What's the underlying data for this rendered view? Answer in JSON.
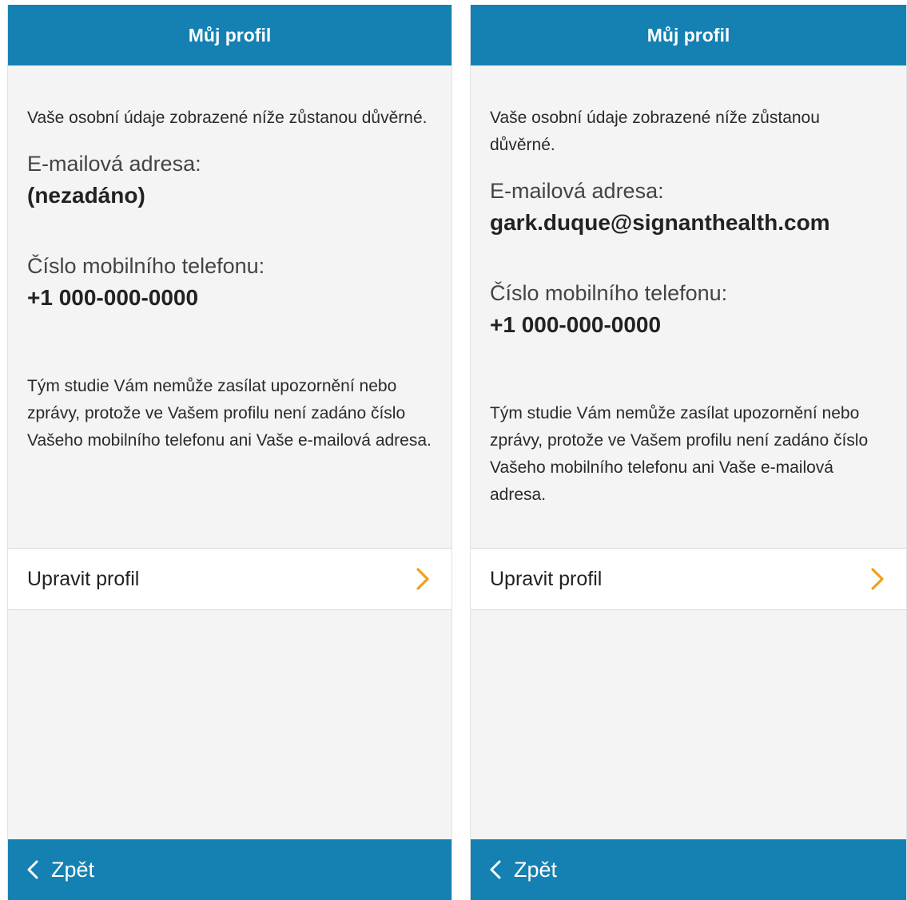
{
  "colors": {
    "header_bg": "#1580b2",
    "accent_chevron": "#f0a01a",
    "screen_bg": "#f4f4f4"
  },
  "screens": [
    {
      "header_title": "Můj profil",
      "intro": "Vaše osobní údaje zobrazené níže zůstanou důvěrné.",
      "email_label": "E-mailová adresa:",
      "email_value": "(nezadáno)",
      "phone_label": "Číslo mobilního telefonu:",
      "phone_value": "+1 000-000-0000",
      "notice": "Tým studie Vám nemůže zasílat upozornění nebo zprávy, protože ve Vašem profilu není zadáno číslo Vašeho mobilního telefonu ani Vaše e-mailová adresa.",
      "edit_profile_label": "Upravit profil",
      "back_label": "Zpět"
    },
    {
      "header_title": "Můj profil",
      "intro": "Vaše osobní údaje zobrazené níže zůstanou důvěrné.",
      "email_label": "E-mailová adresa:",
      "email_value": "gark.duque@signanthealth.com",
      "phone_label": "Číslo mobilního telefonu:",
      "phone_value": "+1 000-000-0000",
      "notice": "Tým studie Vám nemůže zasílat upozornění nebo zprávy, protože ve Vašem profilu není zadáno číslo Vašeho mobilního telefonu ani Vaše e-mailová adresa.",
      "edit_profile_label": "Upravit profil",
      "back_label": "Zpět"
    }
  ]
}
